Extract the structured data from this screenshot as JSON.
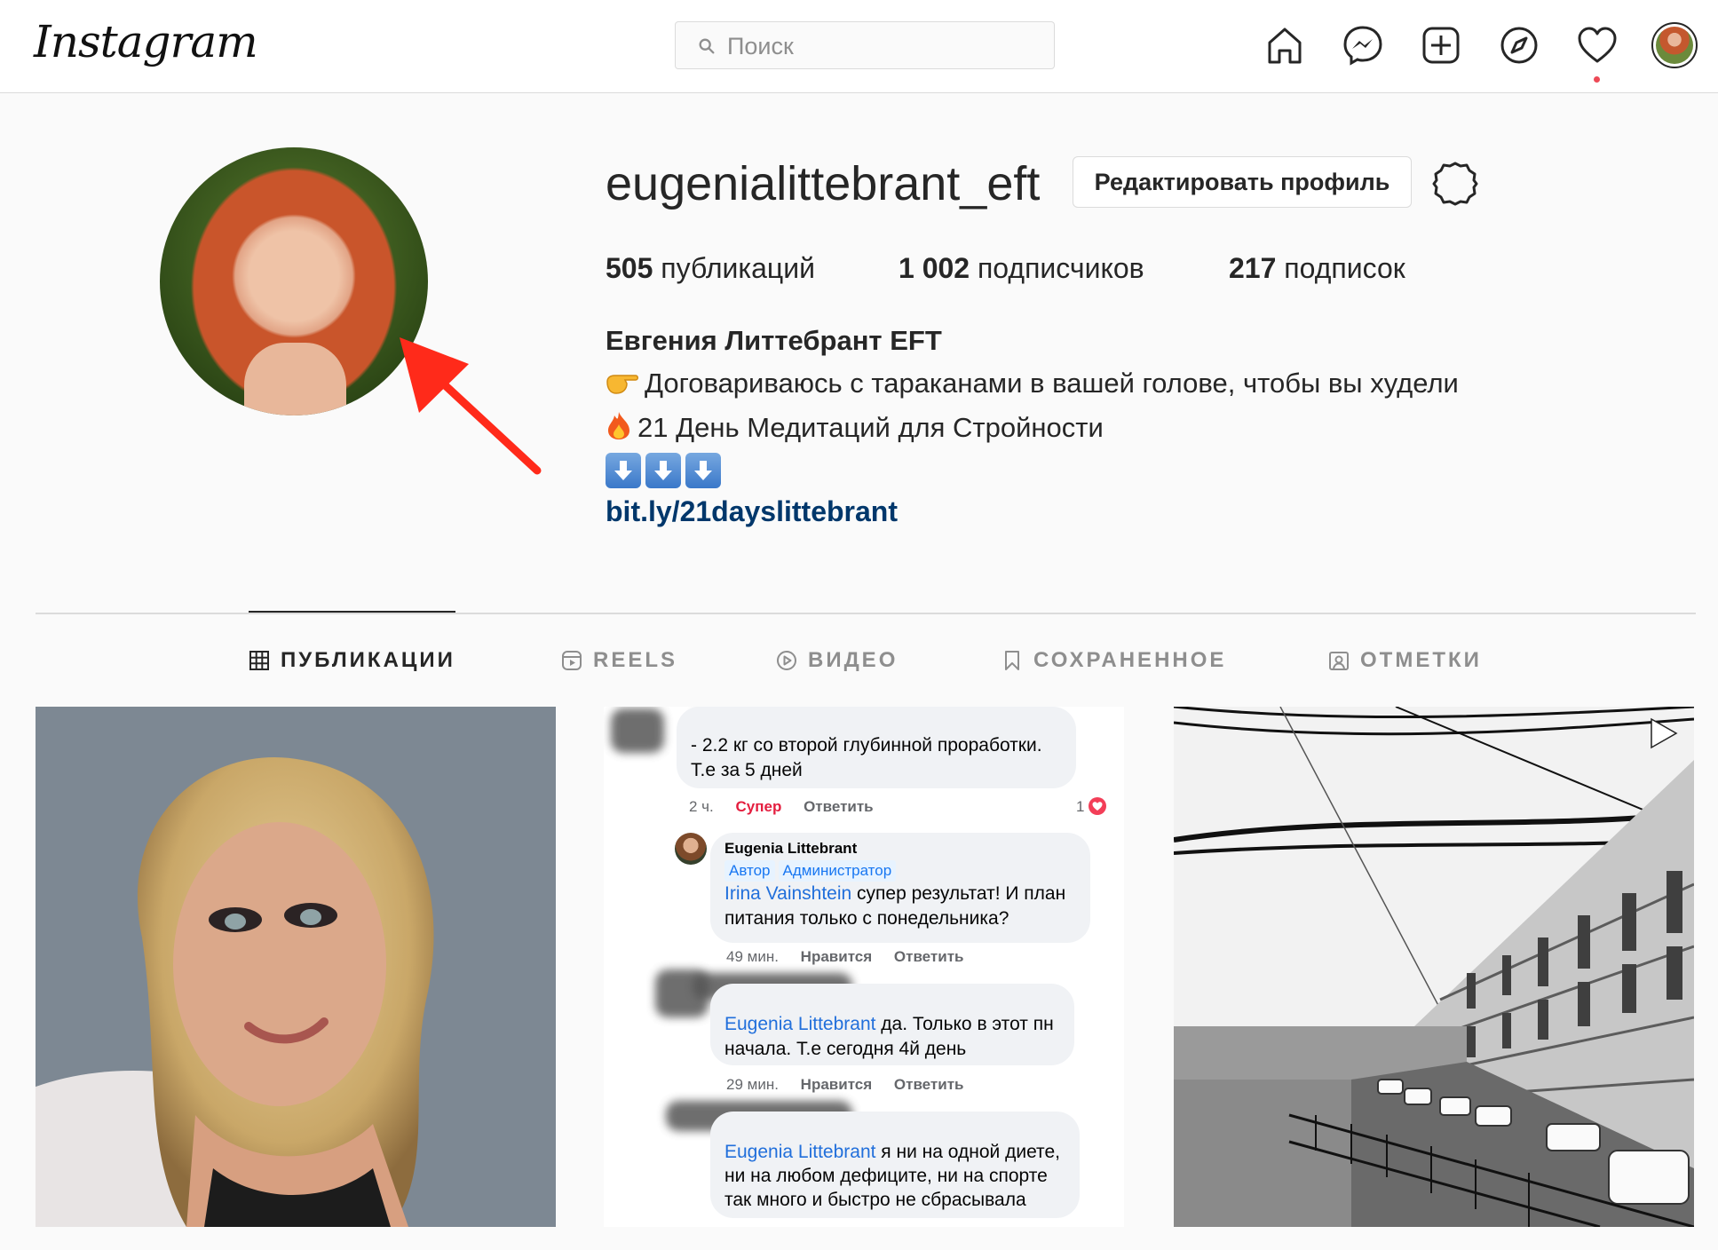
{
  "header": {
    "logo_text": "Instagram",
    "search_placeholder": "Поиск",
    "icons": [
      "home-icon",
      "messenger-icon",
      "new-post-icon",
      "explore-icon",
      "activity-heart-icon"
    ],
    "notification_dot_color": "#ed4956"
  },
  "profile": {
    "username": "eugenialittebrant_eft",
    "edit_button": "Редактировать профиль",
    "stats": {
      "posts_count": "505",
      "posts_label": "публикаций",
      "followers_count": "1 002",
      "followers_label": "подписчиков",
      "following_count": "217",
      "following_label": "подписок"
    },
    "full_name": "Евгения Литтебрант EFT",
    "bio_line1": "Договариваюсь с тараканами в вашей голове, чтобы вы худели",
    "bio_line2": "21 День Медитаций для Стройности",
    "link": "bit.ly/21dayslittebrant",
    "annotation_arrow_color": "#ff2a1a"
  },
  "tabs": [
    {
      "label": "ПУБЛИКАЦИИ",
      "active": true,
      "icon": "grid-icon"
    },
    {
      "label": "REELS",
      "active": false,
      "icon": "reels-icon"
    },
    {
      "label": "ВИДЕО",
      "active": false,
      "icon": "video-icon"
    },
    {
      "label": "СОХРАНЕННОЕ",
      "active": false,
      "icon": "bookmark-icon"
    },
    {
      "label": "ОТМЕТКИ",
      "active": false,
      "icon": "tagged-icon"
    }
  ],
  "posts": {
    "post2": {
      "c1_text": "- 2.2 кг со второй глубинной проработки. Т.е  за 5 дней",
      "c1_time": "2 ч.",
      "c1_react": "Супер",
      "c1_reply": "Ответить",
      "c1_likes": "1",
      "c2_author": "Eugenia Littebrant",
      "c2_badge1": "Автор",
      "c2_badge2": "Администратор",
      "c2_mention": "Irina Vainshtein",
      "c2_text": " супер результат! И план питания только с понедельника?",
      "c2_time": "49 мин.",
      "c2_like": "Нравится",
      "c2_reply": "Ответить",
      "c3_mention": "Eugenia Littebrant",
      "c3_text": " да. Только в этот пн начала. Т.е сегодня 4й день",
      "c3_time": "29 мин.",
      "c3_like": "Нравится",
      "c3_reply": "Ответить",
      "c4_mention": "Eugenia Littebrant",
      "c4_text": " я ни на одной диете, ни на любом дефиците, ни на спорте так много и быстро не сбрасывала"
    },
    "post3_type_icon": "reel-play-icon"
  }
}
